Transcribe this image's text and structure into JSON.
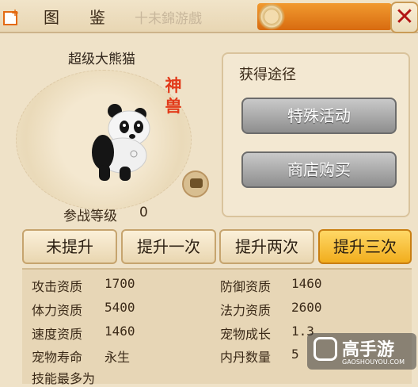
{
  "header": {
    "title": "图鉴",
    "watermark": "十未錦游戲",
    "close": "✕"
  },
  "pet": {
    "name": "超级大熊猫",
    "rarity": "神兽",
    "level_label": "参战等级",
    "level_value": "0"
  },
  "source": {
    "title": "获得途径",
    "buttons": [
      "特殊活动",
      "商店购买"
    ]
  },
  "tabs": [
    {
      "label": "未提升",
      "selected": false
    },
    {
      "label": "提升一次",
      "selected": false
    },
    {
      "label": "提升两次",
      "selected": false
    },
    {
      "label": "提升三次",
      "selected": true
    }
  ],
  "stats": {
    "rows": [
      {
        "l1": "攻击资质",
        "v1": "1700",
        "l2": "防御资质",
        "v2": "1460"
      },
      {
        "l1": "体力资质",
        "v1": "5400",
        "l2": "法力资质",
        "v2": "2600"
      },
      {
        "l1": "速度资质",
        "v1": "1460",
        "l2": "宠物成长",
        "v2": "1.3"
      },
      {
        "l1": "宠物寿命",
        "v1": "永生",
        "l2": "内丹数量",
        "v2": "5"
      }
    ],
    "footer": "技能最多为"
  },
  "watermark_badge": {
    "text": "高手游",
    "sub": "GAOSHOUYOU.COM"
  },
  "colors": {
    "accent_orange": "#e36a12",
    "selected_tab": "#f1ad1d",
    "rarity_red": "#e23a1a"
  }
}
